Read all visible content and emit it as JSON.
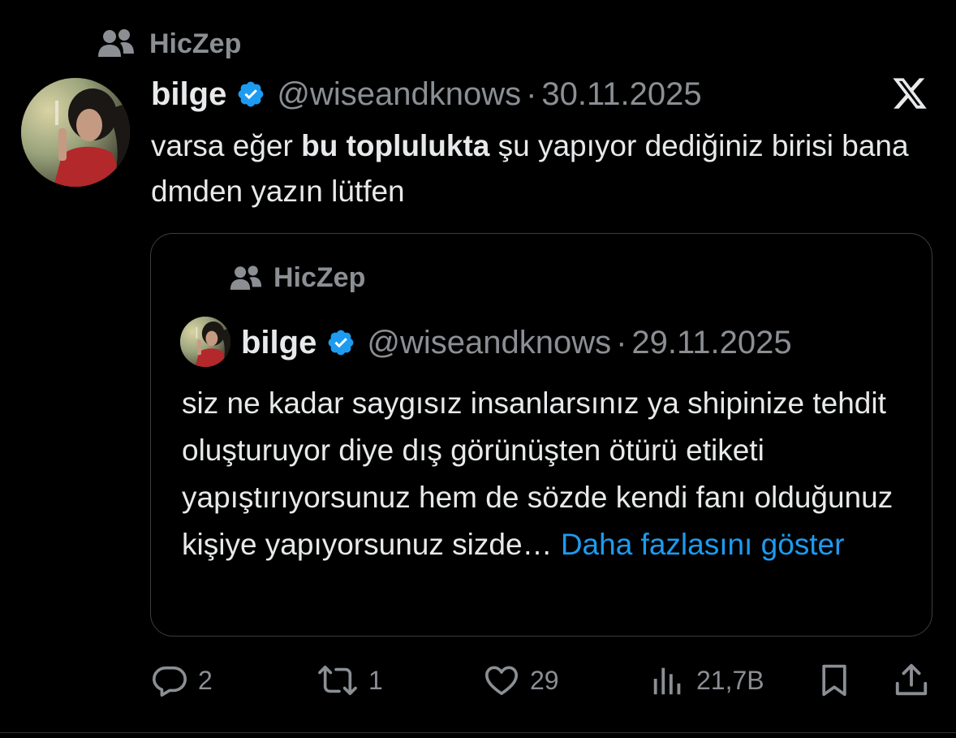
{
  "tweet": {
    "community": "HicZep",
    "author": {
      "name": "bilge",
      "handle": "@wiseandknows",
      "separator": "·",
      "date": "30.11.2025"
    },
    "text": {
      "part1": "varsa eğer ",
      "bold": "bu toplulukta",
      "part2": " şu yapıyor dediğiniz birisi bana dmden yazın lütfen"
    },
    "quoted": {
      "community": "HicZep",
      "author": {
        "name": "bilge",
        "handle": "@wiseandknows",
        "separator": "·",
        "date": "29.11.2025"
      },
      "text": "siz ne kadar saygısız insanlarsınız ya shipinize tehdit oluşturuyor diye dış görünüşten ötürü etiketi yapıştırıyorsunuz hem de sözde kendi fanı olduğunuz kişiye yapıyorsunuz sizde… ",
      "show_more": "Daha fazlasını göster"
    },
    "actions": {
      "replies": "2",
      "reposts": "1",
      "likes": "29",
      "views": "21,7B"
    }
  },
  "icons": {
    "community": "people-icon",
    "verified": "verified-badge-icon",
    "logo": "x-logo-icon",
    "reply": "reply-icon",
    "repost": "repost-icon",
    "like": "heart-icon",
    "views": "views-chart-icon",
    "bookmark": "bookmark-icon",
    "share": "share-icon"
  },
  "colors": {
    "background": "#000000",
    "text": "#e7e9ea",
    "muted": "#8b8f94",
    "link": "#1d9bf0",
    "verified": "#1d9bf0",
    "border": "#3a3d41"
  }
}
